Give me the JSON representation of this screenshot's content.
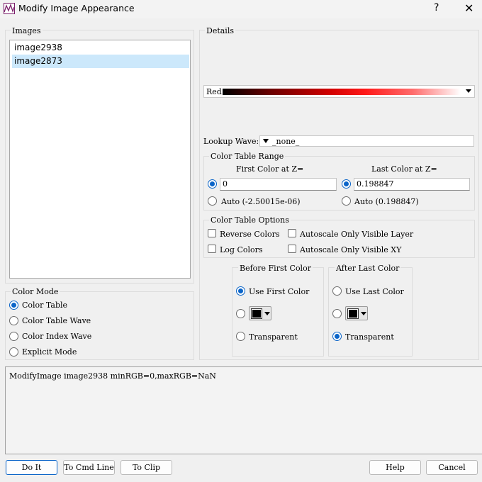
{
  "window": {
    "title": "Modify Image Appearance",
    "help": "?",
    "close": "✕"
  },
  "images": {
    "label": "Images",
    "items": [
      "image2938",
      "image2873"
    ],
    "selected_index": 1
  },
  "color_mode": {
    "label": "Color Mode",
    "options": [
      "Color Table",
      "Color Table Wave",
      "Color Index Wave",
      "Explicit Mode"
    ],
    "selected_index": 0
  },
  "details": {
    "label": "Details",
    "color_table": "Red",
    "lookup_wave_label": "Lookup Wave:",
    "lookup_wave_value": "_none_"
  },
  "range": {
    "label": "Color Table Range",
    "first_header": "First Color at Z=",
    "last_header": "Last Color at Z=",
    "first_value": "0",
    "last_value": "0.198847",
    "first_auto": "Auto (-2.50015e-06)",
    "last_auto": "Auto (0.198847)"
  },
  "options": {
    "label": "Color Table Options",
    "reverse": "Reverse Colors",
    "log": "Log Colors",
    "autoscale_layer": "Autoscale Only Visible Layer",
    "autoscale_xy": "Autoscale Only Visible XY"
  },
  "before": {
    "label": "Before First Color",
    "use_first": "Use First Color",
    "transparent": "Transparent",
    "selected": "use_first"
  },
  "after": {
    "label": "After Last Color",
    "use_last": "Use Last Color",
    "transparent": "Transparent",
    "selected": "transparent"
  },
  "command": "ModifyImage image2938 minRGB=0,maxRGB=NaN",
  "buttons": {
    "do_it": "Do It",
    "to_cmd_line": "To Cmd Line",
    "to_clip": "To Clip",
    "help": "Help",
    "cancel": "Cancel"
  },
  "colors": {
    "accent": "#0a64c8",
    "selection": "#cce8fb"
  }
}
